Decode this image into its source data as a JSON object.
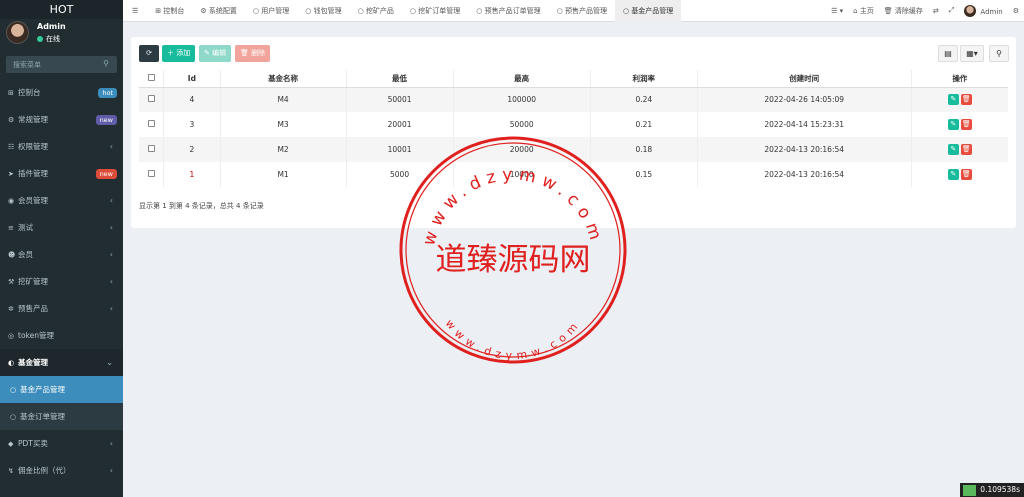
{
  "app": {
    "logo": "HOT"
  },
  "user": {
    "name": "Admin",
    "status": "在线"
  },
  "search": {
    "placeholder": "搜索菜单"
  },
  "menu": [
    {
      "label": "控制台",
      "icon": "dashboard-icon",
      "badge": "hot",
      "badge_color": "#3c8dbc"
    },
    {
      "label": "常规管理",
      "icon": "cogs-icon",
      "badge": "new",
      "badge_color": "#605ca8"
    },
    {
      "label": "权限管理",
      "icon": "group-icon"
    },
    {
      "label": "插件管理",
      "icon": "rocket-icon",
      "badge": "new",
      "badge_color": "#dd4b39"
    },
    {
      "label": "会员管理",
      "icon": "user-circle-icon"
    },
    {
      "label": "测试",
      "icon": "list-icon"
    },
    {
      "label": "会员",
      "icon": "user-icon"
    },
    {
      "label": "挖矿管理",
      "icon": "pickaxe-icon"
    },
    {
      "label": "预售产品",
      "icon": "shopping-icon"
    },
    {
      "label": "token管理",
      "icon": "coin-icon"
    },
    {
      "label": "基金管理",
      "icon": "adjust-icon",
      "open": true
    },
    {
      "label": "基金产品管理",
      "icon": "circle-icon",
      "sub": true,
      "active": true
    },
    {
      "label": "基金订单管理",
      "icon": "circle-icon",
      "sub": true
    },
    {
      "label": "PDT买卖",
      "icon": "exchange-icon"
    },
    {
      "label": "佣金比例（代）",
      "icon": "bolt-icon"
    }
  ],
  "tabs": [
    {
      "label": "控制台",
      "icon": "dashboard-icon"
    },
    {
      "label": "系统配置",
      "icon": "cog-icon"
    },
    {
      "label": "用户管理",
      "icon": "circle-icon"
    },
    {
      "label": "钱包管理",
      "icon": "circle-icon"
    },
    {
      "label": "挖矿产品",
      "icon": "circle-icon"
    },
    {
      "label": "挖矿订单管理",
      "icon": "circle-icon"
    },
    {
      "label": "预售产品订单管理",
      "icon": "circle-icon"
    },
    {
      "label": "预售产品管理",
      "icon": "circle-icon"
    },
    {
      "label": "基金产品管理",
      "icon": "circle-icon",
      "active": true
    }
  ],
  "topright": {
    "home": "主页",
    "clear_cache": "清除缓存",
    "admin": "Admin"
  },
  "toolbar": {
    "add": "添加",
    "edit": "编辑",
    "delete": "删除",
    "colors": {
      "refresh": "#2c3b41",
      "add": "#18bc9c",
      "edit": "#8ed9c9",
      "delete": "#f0a49b"
    }
  },
  "table": {
    "headers": [
      "Id",
      "基金名称",
      "最低",
      "最高",
      "利润率",
      "创建时间",
      "操作"
    ],
    "rows": [
      {
        "id": "4",
        "name": "M4",
        "min": "50001",
        "max": "100000",
        "rate": "0.24",
        "time": "2022-04-26 14:05:09"
      },
      {
        "id": "3",
        "name": "M3",
        "min": "20001",
        "max": "50000",
        "rate": "0.21",
        "time": "2022-04-14 15:23:31"
      },
      {
        "id": "2",
        "name": "M2",
        "min": "10001",
        "max": "20000",
        "rate": "0.18",
        "time": "2022-04-13 20:16:54"
      },
      {
        "id": "1",
        "name": "M1",
        "min": "5000",
        "max": "10000",
        "rate": "0.15",
        "time": "2022-04-13 20:16:54"
      }
    ]
  },
  "pagination": {
    "summary": "显示第 1 到第 4 条记录，总共 4 条记录"
  },
  "watermark": {
    "text": "道臻源码网",
    "top_arc": "www.dzymw.com",
    "bottom_arc": "www.dzymw.com",
    "color": "#e0201e"
  },
  "timer": {
    "value": "0.109538s"
  }
}
